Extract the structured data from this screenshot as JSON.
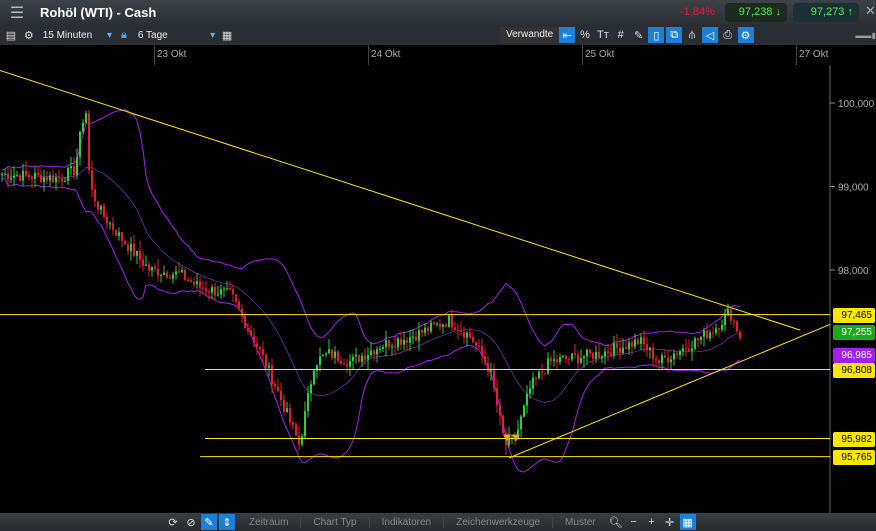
{
  "header": {
    "title": "Rohöl (WTI) - Cash",
    "change": "-1,84%",
    "sell": "97,238",
    "buy": "97,273"
  },
  "toolbar": {
    "interval": "15 Minuten",
    "range": "6 Tage",
    "related": "Verwandte"
  },
  "bottom": {
    "tabs": [
      "Zeitraum",
      "Chart Typ",
      "Indikatoren",
      "Zeichenwerkzeuge",
      "Muster"
    ]
  },
  "colors": {
    "accent": "#1d7fd6",
    "level": "#ffe600",
    "current": "#1ea81e",
    "band": "#a020f0"
  },
  "chart_data": {
    "type": "candlestick",
    "x_ticks": [
      {
        "t": 0,
        "label": "23 Okt"
      },
      {
        "t": 1,
        "label": "24 Okt"
      },
      {
        "t": 2,
        "label": "25 Okt"
      },
      {
        "t": 3,
        "label": "27 Okt"
      }
    ],
    "y_ticks": [
      {
        "v": 100,
        "label": "100,000"
      },
      {
        "v": 99,
        "label": "99,000"
      },
      {
        "v": 98,
        "label": "98,000"
      }
    ],
    "ylim": [
      94.8,
      100.5
    ],
    "price_path": [
      [
        -0.72,
        99.15
      ],
      [
        -0.44,
        99.1
      ],
      [
        -0.37,
        99.2
      ],
      [
        -0.32,
        100.0
      ],
      [
        -0.3,
        99.0
      ],
      [
        -0.25,
        98.7
      ],
      [
        -0.16,
        98.4
      ],
      [
        -0.02,
        98.0
      ],
      [
        0.12,
        97.95
      ],
      [
        0.21,
        97.8
      ],
      [
        0.36,
        97.7
      ],
      [
        0.5,
        97.0
      ],
      [
        0.57,
        96.6
      ],
      [
        0.68,
        95.9
      ],
      [
        0.75,
        96.9
      ],
      [
        0.82,
        97.0
      ],
      [
        0.92,
        96.9
      ],
      [
        1.06,
        97.1
      ],
      [
        1.2,
        97.2
      ],
      [
        1.38,
        97.4
      ],
      [
        1.48,
        97.2
      ],
      [
        1.57,
        96.8
      ],
      [
        1.64,
        95.9
      ],
      [
        1.69,
        96.0
      ],
      [
        1.76,
        96.6
      ],
      [
        1.85,
        96.9
      ],
      [
        2.08,
        97.0
      ],
      [
        2.27,
        97.15
      ],
      [
        2.36,
        96.9
      ],
      [
        2.5,
        97.1
      ],
      [
        2.62,
        97.3
      ],
      [
        2.69,
        97.5
      ],
      [
        2.74,
        97.2
      ]
    ],
    "levels": [
      {
        "v": 97.465,
        "label": "97,465"
      },
      {
        "v": 96.808,
        "label": "96,808"
      },
      {
        "v": 95.982,
        "label": "95,982"
      },
      {
        "v": 95.765,
        "label": "95,765"
      }
    ],
    "current": {
      "v": 97.255,
      "label": "97,255"
    },
    "band_value": {
      "v": 96.985,
      "label": "96,985"
    },
    "trendlines": [
      [
        [
          -0.72,
          100.39
        ],
        [
          3.02,
          97.28
        ]
      ],
      [
        [
          1.66,
          95.75
        ],
        [
          3.16,
          97.35
        ]
      ]
    ]
  }
}
